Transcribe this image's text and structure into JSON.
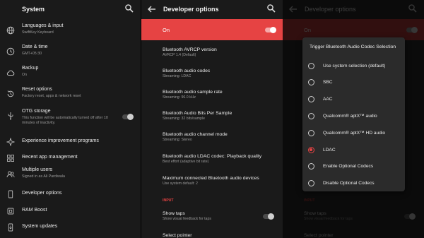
{
  "colors": {
    "accent": "#e64343",
    "background": "#1a1a1a",
    "dialog": "#2b2b2b"
  },
  "settings": {
    "title": "System",
    "items": [
      {
        "icon": "globe-icon",
        "title": "Languages & input",
        "subtitle": "SwiftKey Keyboard"
      },
      {
        "icon": "clock-icon",
        "title": "Date & time",
        "subtitle": "GMT+05:30"
      },
      {
        "icon": "backup-icon",
        "title": "Backup",
        "subtitle": "On"
      },
      {
        "icon": "reset-icon",
        "title": "Reset options",
        "subtitle": "Factory reset, apps & network reset"
      },
      {
        "icon": "usb-icon",
        "title": "OTG storage",
        "subtitle": "This function will be automatically turned off after 10 minutes of inactivity."
      },
      {
        "icon": "sparkle-icon",
        "title": "Experience improvement programs",
        "subtitle": ""
      },
      {
        "icon": "apps-icon",
        "title": "Recent app management",
        "subtitle": ""
      },
      {
        "icon": "users-icon",
        "title": "Multiple users",
        "subtitle": "Signed in as Ali Pardiwala"
      },
      {
        "icon": "phone-icon",
        "title": "Developer options",
        "subtitle": ""
      },
      {
        "icon": "ram-icon",
        "title": "RAM Boost",
        "subtitle": ""
      },
      {
        "icon": "update-icon",
        "title": "System updates",
        "subtitle": ""
      }
    ]
  },
  "developer": {
    "title": "Developer options",
    "on_label": "On",
    "items": [
      {
        "title": "Bluetooth AVRCP version",
        "subtitle": "AVRCP 1.4 (Default)"
      },
      {
        "title": "Bluetooth audio codec",
        "subtitle": "Streaming: LDAC"
      },
      {
        "title": "Bluetooth audio sample rate",
        "subtitle": "Streaming: 96.0 kHz"
      },
      {
        "title": "Bluetooth Audio Bits Per Sample",
        "subtitle": "Streaming: 32 bits/sample"
      },
      {
        "title": "Bluetooth audio channel mode",
        "subtitle": "Streaming: Stereo"
      },
      {
        "title": "Bluetooth audio LDAC codec: Playback quality",
        "subtitle": "Best effort (adaptive bit rate)"
      },
      {
        "title": "Maximum connected Bluetooth audio devices",
        "subtitle": "Use system default: 2"
      }
    ],
    "section_input": "INPUT",
    "show_taps": {
      "title": "Show taps",
      "subtitle": "Show visual feedback for taps"
    },
    "cut_item": "Select pointer"
  },
  "dialog": {
    "title": "Trigger Bluetooth Audio Codec Selection",
    "options": [
      "Use system selection (default)",
      "SBC",
      "AAC",
      "Qualcomm® aptX™ audio",
      "Qualcomm® aptX™ HD audio",
      "LDAC",
      "Enable Optional Codecs",
      "Disable Optional Codecs"
    ],
    "selected": "LDAC"
  }
}
